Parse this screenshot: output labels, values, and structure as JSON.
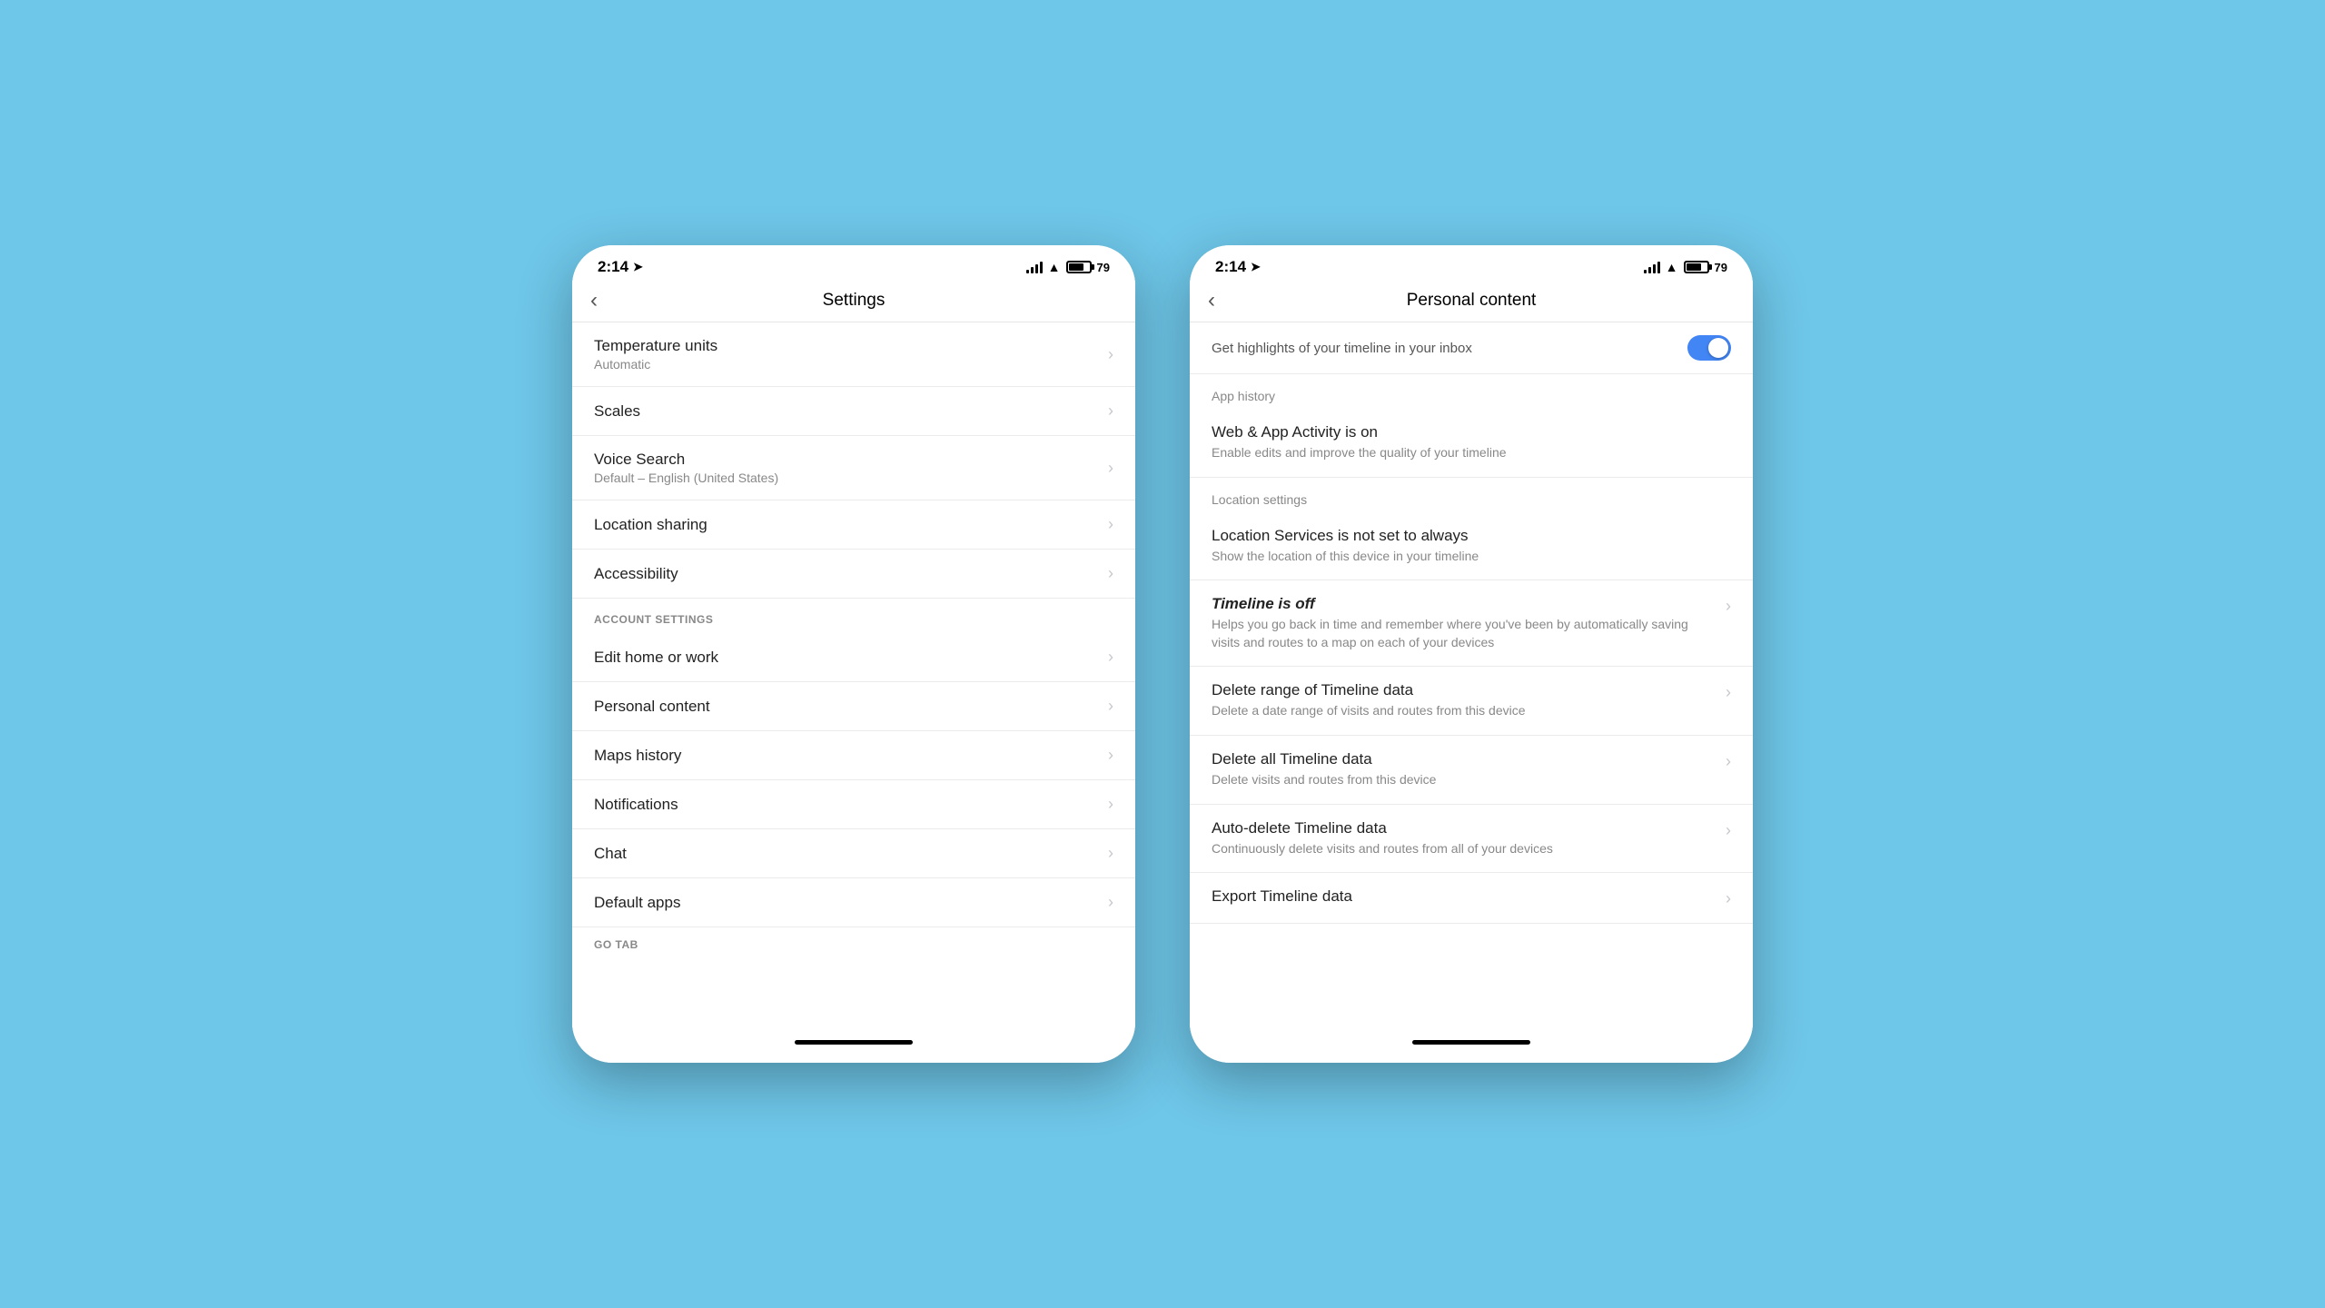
{
  "background_color": "#6ec6e8",
  "phone1": {
    "status": {
      "time": "2:14",
      "has_location": true
    },
    "header": {
      "back_label": "‹",
      "title": "Settings"
    },
    "items": [
      {
        "title": "Temperature units",
        "subtitle": "Automatic"
      },
      {
        "title": "Scales",
        "subtitle": ""
      },
      {
        "title": "Voice Search",
        "subtitle": "Default – English (United States)"
      },
      {
        "title": "Location sharing",
        "subtitle": ""
      },
      {
        "title": "Accessibility",
        "subtitle": ""
      }
    ],
    "section_account": "ACCOUNT SETTINGS",
    "account_items": [
      {
        "title": "Edit home or work",
        "subtitle": ""
      },
      {
        "title": "Personal content",
        "subtitle": ""
      },
      {
        "title": "Maps history",
        "subtitle": ""
      },
      {
        "title": "Notifications",
        "subtitle": ""
      },
      {
        "title": "Chat",
        "subtitle": ""
      },
      {
        "title": "Default apps",
        "subtitle": ""
      }
    ],
    "go_tab_label": "GO TAB"
  },
  "phone2": {
    "status": {
      "time": "2:14",
      "has_location": true
    },
    "header": {
      "back_label": "‹",
      "title": "Personal content"
    },
    "top_item": {
      "text": "Get highlights of your timeline in your inbox"
    },
    "sections": [
      {
        "label": "App history",
        "items": [
          {
            "title": "Web & App Activity is on",
            "subtitle": "Enable edits and improve the quality of your timeline",
            "bold_italic": false
          }
        ]
      },
      {
        "label": "Location settings",
        "items": [
          {
            "title": "Location Services is not set to always",
            "subtitle": "Show the location of this device in your timeline",
            "bold_italic": false
          },
          {
            "title": "Timeline is off",
            "subtitle": "Helps you go back in time and remember where you've been by automatically saving visits and routes to a map on each of your devices",
            "bold_italic": true
          }
        ]
      },
      {
        "label": "",
        "items": [
          {
            "title": "Delete range of Timeline data",
            "subtitle": "Delete a date range of visits and routes from this device",
            "bold_italic": false
          },
          {
            "title": "Delete all Timeline data",
            "subtitle": "Delete visits and routes from this device",
            "bold_italic": false
          },
          {
            "title": "Auto-delete Timeline data",
            "subtitle": "Continuously delete visits and routes from all of your devices",
            "bold_italic": false
          },
          {
            "title": "Export Timeline data",
            "subtitle": "",
            "bold_italic": false
          }
        ]
      }
    ]
  }
}
